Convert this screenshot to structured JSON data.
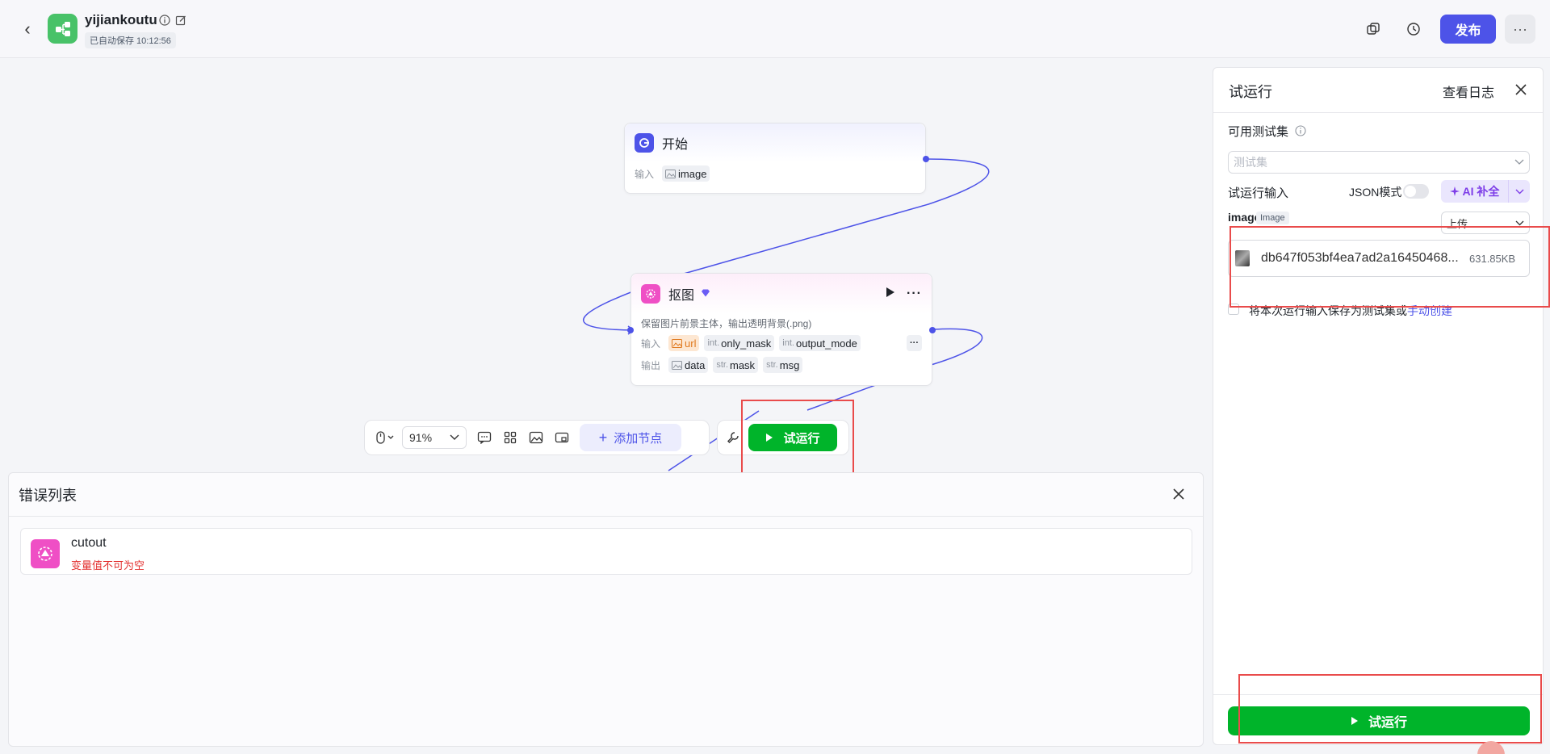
{
  "header": {
    "title": "yijiankoutu",
    "autosave": "已自动保存 10:12:56",
    "publish_label": "发布",
    "more_label": "···"
  },
  "canvas": {
    "start_node": {
      "title": "开始",
      "input_label": "输入",
      "input_param": "image"
    },
    "cutout_node": {
      "title": "抠图",
      "desc": "保留图片前景主体，输出透明背景(.png)",
      "input_label": "输入",
      "output_label": "输出",
      "inputs": [
        {
          "prefix": "",
          "name": "url"
        },
        {
          "prefix": "int.",
          "name": "only_mask"
        },
        {
          "prefix": "int.",
          "name": "output_mode"
        }
      ],
      "outputs": [
        {
          "prefix": "",
          "name": "data"
        },
        {
          "prefix": "str.",
          "name": "mask"
        },
        {
          "prefix": "str.",
          "name": "msg"
        }
      ],
      "more": "···"
    },
    "toolbar": {
      "zoom": "91%",
      "add_node_label": "添加节点",
      "run_label": "试运行"
    }
  },
  "error_panel": {
    "title": "错误列表",
    "items": [
      {
        "name": "cutout",
        "message": "变量值不可为空"
      }
    ]
  },
  "test_run_panel": {
    "title": "试运行",
    "log_label": "查看日志",
    "test_set_label": "可用测试集",
    "test_set_placeholder": "测试集",
    "input_label": "试运行输入",
    "json_mode_label": "JSON模式",
    "ai_label": "AI 补全",
    "param_name": "image",
    "param_type": "Image",
    "upload_label": "上传",
    "file_name": "db647f053bf4ea7ad2a16450468...",
    "file_size": "631.85KB",
    "save_text": "将本次运行输入保存为测试集或",
    "save_link": "手动创建",
    "run_label": "试运行"
  },
  "colors": {
    "accent": "#4d53e8",
    "run_green": "#00b42a",
    "error_red": "#e3302f",
    "app_logo": "#48c268",
    "cutout_pink": "#ef4fc5"
  }
}
